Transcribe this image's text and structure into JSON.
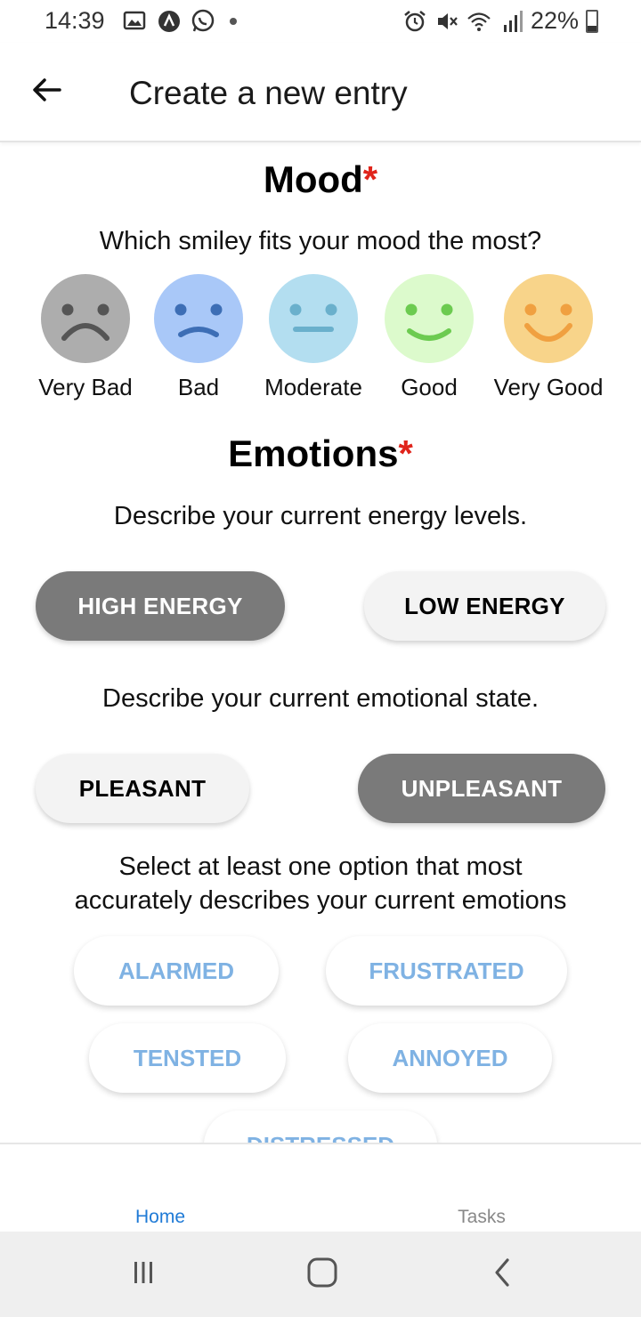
{
  "status_bar": {
    "time": "14:39",
    "battery": "22%",
    "left_icons": [
      "image-icon",
      "app-notification-icon",
      "whatsapp-icon",
      "dot-icon"
    ],
    "right_icons": [
      "alarm-icon",
      "mute-icon",
      "wifi-icon",
      "signal-icon",
      "battery-icon"
    ]
  },
  "app_bar": {
    "title": "Create a new entry",
    "back_icon": "arrow-left-icon"
  },
  "mood": {
    "title": "Mood",
    "required_mark": "*",
    "prompt": "Which smiley fits your mood the most?",
    "options": [
      {
        "label": "Very Bad",
        "color": "#adadad",
        "feature_color": "#555555"
      },
      {
        "label": "Bad",
        "color": "#a9c8f8",
        "feature_color": "#3d6eb5"
      },
      {
        "label": "Moderate",
        "color": "#b3def0",
        "feature_color": "#6ab0cc"
      },
      {
        "label": "Good",
        "color": "#dcfacc",
        "feature_color": "#6ccb50"
      },
      {
        "label": "Very Good",
        "color": "#f8d48a",
        "feature_color": "#f0a040"
      }
    ]
  },
  "emotions": {
    "title": "Emotions",
    "required_mark": "*",
    "energy_prompt": "Describe your current energy levels.",
    "energy_options": [
      {
        "label": "HIGH ENERGY",
        "selected": true
      },
      {
        "label": "LOW ENERGY",
        "selected": false
      }
    ],
    "state_prompt": "Describe your current emotional state.",
    "state_options": [
      {
        "label": "PLEASANT",
        "selected": false
      },
      {
        "label": "UNPLEASANT",
        "selected": true
      }
    ],
    "select_prompt_line1": "Select at least one option that most",
    "select_prompt_line2": "accurately describes your current emotions",
    "chips": [
      "ALARMED",
      "FRUSTRATED",
      "TENSTED",
      "ANNOYED",
      "DISTRESSED"
    ]
  },
  "bottom_tabs": {
    "home": "Home",
    "tasks": "Tasks",
    "active": "Home"
  },
  "colors": {
    "accent": "#1f7ad6",
    "required": "#e0241b",
    "selected_button": "#7a7a7a",
    "chip_text": "#7fb2e3"
  }
}
